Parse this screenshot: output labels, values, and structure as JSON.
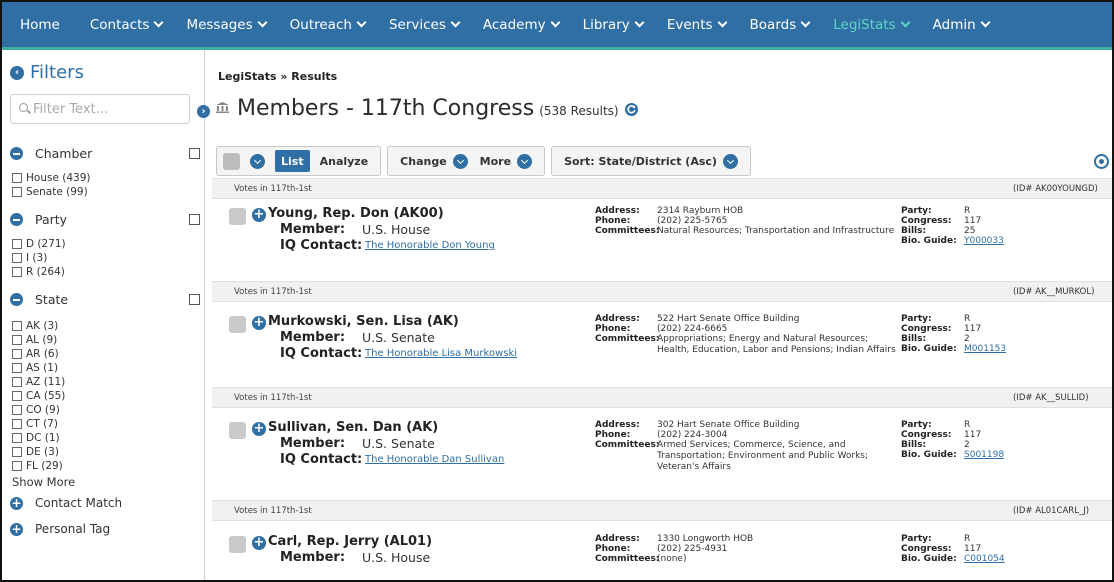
{
  "nav": {
    "items": [
      {
        "label": "Home",
        "dropdown": false
      },
      {
        "label": "Contacts",
        "dropdown": true
      },
      {
        "label": "Messages",
        "dropdown": true
      },
      {
        "label": "Outreach",
        "dropdown": true
      },
      {
        "label": "Services",
        "dropdown": true
      },
      {
        "label": "Academy",
        "dropdown": true
      },
      {
        "label": "Library",
        "dropdown": true
      },
      {
        "label": "Events",
        "dropdown": true
      },
      {
        "label": "Boards",
        "dropdown": true
      },
      {
        "label": "LegiStats",
        "dropdown": true,
        "active": true
      },
      {
        "label": "Admin",
        "dropdown": true
      }
    ]
  },
  "sidebar": {
    "title": "Filters",
    "filter_placeholder": "Filter Text...",
    "sections": {
      "chamber": {
        "label": "Chamber",
        "options": [
          "House (439)",
          "Senate (99)"
        ]
      },
      "party": {
        "label": "Party",
        "options": [
          "D (271)",
          "I (3)",
          "R (264)"
        ]
      },
      "state": {
        "label": "State",
        "options": [
          "AK (3)",
          "AL (9)",
          "AR (6)",
          "AS (1)",
          "AZ (11)",
          "CA (55)",
          "CO (9)",
          "CT (7)",
          "DC (1)",
          "DE (3)",
          "FL (29)"
        ]
      }
    },
    "show_more": "Show More",
    "contact_match": "Contact Match",
    "personal_tag": "Personal Tag"
  },
  "main": {
    "breadcrumb": "LegiStats » Results",
    "title": "Members - 117th Congress",
    "results": "(538 Results)",
    "toolbar": {
      "list": "List",
      "analyze": "Analyze",
      "change": "Change",
      "more": "More",
      "sort": "Sort: State/District (Asc)"
    }
  },
  "labels": {
    "member": "Member:",
    "iq_contact": "IQ Contact:",
    "address": "Address:",
    "phone": "Phone:",
    "committees": "Committees:",
    "party": "Party:",
    "congress": "Congress:",
    "bills": "Bills:",
    "bio_guide": "Bio. Guide:"
  },
  "records": [
    {
      "votes": "Votes in 117th-1st",
      "id": "(ID# AK00YOUNGD)",
      "name": "Young, Rep. Don (AK00)",
      "member": "U.S. House",
      "iq_contact": "The Honorable Don Young",
      "address": "2314 Rayburn HOB",
      "phone": "(202) 225-5765",
      "committees": "Natural Resources; Transportation and Infrastructure",
      "party": "R",
      "congress": "117",
      "bills": "25",
      "bio_guide": "Y000033"
    },
    {
      "votes": "Votes in 117th-1st",
      "id": "(ID# AK__MURKOL)",
      "name": "Murkowski, Sen. Lisa (AK)",
      "member": "U.S. Senate",
      "iq_contact": "The Honorable Lisa Murkowski",
      "address": "522 Hart Senate Office Building",
      "phone": "(202) 224-6665",
      "committees": "Appropriations; Energy and Natural Resources; Health, Education, Labor and Pensions; Indian Affairs",
      "party": "R",
      "congress": "117",
      "bills": "2",
      "bio_guide": "M001153"
    },
    {
      "votes": "Votes in 117th-1st",
      "id": "(ID# AK__SULLID)",
      "name": "Sullivan, Sen. Dan (AK)",
      "member": "U.S. Senate",
      "iq_contact": "The Honorable Dan Sullivan",
      "address": "302 Hart Senate Office Building",
      "phone": "(202) 224-3004",
      "committees": "Armed Services; Commerce, Science, and Transportation; Environment and Public Works; Veteran's Affairs",
      "party": "R",
      "congress": "117",
      "bills": "2",
      "bio_guide": "S001198"
    },
    {
      "votes": "Votes in 117th-1st",
      "id": "(ID# AL01CARL_J)",
      "name": "Carl, Rep. Jerry (AL01)",
      "member": "U.S. House",
      "address": "1330 Longworth HOB",
      "phone": "(202) 225-4931",
      "committees": "(none)",
      "party": "R",
      "congress": "117",
      "bio_guide": "C001054"
    }
  ]
}
